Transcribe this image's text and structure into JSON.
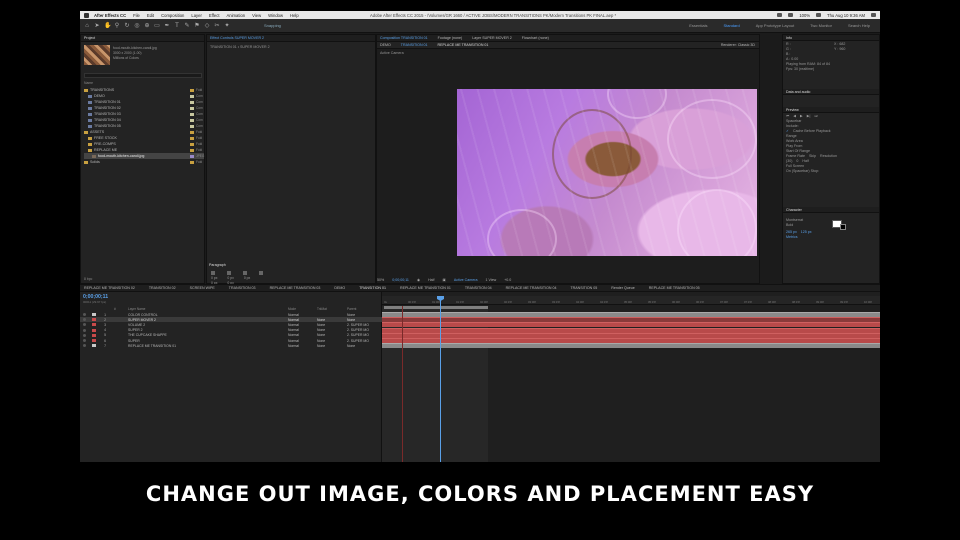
{
  "menubar": {
    "app": "After Effects CC",
    "items": [
      "File",
      "Edit",
      "Composition",
      "Layer",
      "Effect",
      "Animation",
      "View",
      "Window",
      "Help"
    ],
    "doc_title": "Adobe After Effects CC 2015 - /Volumes/GR 1660 / ACTIVE JOBS/MODERN TRANSITIONS PK/Modern Transitions PK FINAL.aep *",
    "status": "Thu Aug 10  9:36 AM",
    "battery": "100%"
  },
  "toolbar": {
    "snapping": "Snapping",
    "workspaces": [
      "Essentials",
      "Standard",
      "App Prototype Layout",
      "Two Monitor"
    ],
    "active_workspace": "Standard",
    "search": "Search Help"
  },
  "project": {
    "tab": "Project",
    "effect_tab": "Effect Controls SUPER MOVER 2",
    "item_name": "food-mouth-kitchen-candi.jpg",
    "item_info": [
      "3000 x 2000 (1.00)",
      "Millions of Colors"
    ],
    "col_name": "Name",
    "rows": [
      {
        "name": "TRANSITIONS",
        "type": "folder",
        "kind": "Fold",
        "indent": 0
      },
      {
        "name": "DEMO",
        "type": "comp",
        "kind": "Com",
        "indent": 1
      },
      {
        "name": "TRANSITION 01",
        "type": "comp",
        "kind": "Com",
        "indent": 1
      },
      {
        "name": "TRANSITION 02",
        "type": "comp",
        "kind": "Com",
        "indent": 1
      },
      {
        "name": "TRANSITION 03",
        "type": "comp",
        "kind": "Com",
        "indent": 1
      },
      {
        "name": "TRANSITION 04",
        "type": "comp",
        "kind": "Com",
        "indent": 1
      },
      {
        "name": "TRANSITION 05",
        "type": "comp",
        "kind": "Com",
        "indent": 1
      },
      {
        "name": "ASSETS",
        "type": "folder",
        "kind": "Fold",
        "indent": 0
      },
      {
        "name": "FREE STOCK",
        "type": "folder",
        "kind": "Fold",
        "indent": 1
      },
      {
        "name": "PRE-COMPS",
        "type": "folder",
        "kind": "Fold",
        "indent": 1
      },
      {
        "name": "REPLACE ME",
        "type": "folder",
        "kind": "Fold",
        "indent": 1
      },
      {
        "name": "food-mouth-kitchen-candi.jpg",
        "type": "image",
        "kind": "JPEG",
        "indent": 2,
        "selected": true
      },
      {
        "name": "Solids",
        "type": "folder",
        "kind": "Fold",
        "indent": 0
      }
    ],
    "footer": "8 bpc"
  },
  "effect_controls": {
    "subtitle": "TRANSITION 01 • SUPER MOVER 2"
  },
  "paragraph": {
    "tab": "Paragraph",
    "rows": [
      [
        "0 px",
        "0 px",
        "0 px"
      ],
      [
        "0 px",
        "0 px"
      ]
    ]
  },
  "viewer": {
    "tabs": [
      "Composition TRANSITION 01",
      "Footage (none)",
      "Layer SUPER MOVER 2",
      "Flowchart (none)"
    ],
    "crumbs": [
      "DEMO",
      "TRANSITION 01",
      "REPLACE ME TRANSITION 01"
    ],
    "camera": "Active Camera",
    "renderer_label": "Renderer:",
    "renderer": "Classic 3D",
    "zoom": "50%",
    "timecode": "0;00;00;11",
    "resolution": "Half",
    "view_camera": "Active Camera",
    "views": "1 View",
    "exposure": "+0.0"
  },
  "right_panel": {
    "info_tab": "Info",
    "info_lines": [
      "R :",
      "G :",
      "B :",
      "A : 0.00",
      "X : 682",
      "Y : 960"
    ],
    "info_footer": [
      "Playing from RAM: 84 of 84",
      "Fps: 30 (realtime)"
    ],
    "audio_tab": "Data and audio",
    "preview_tab": "Preview",
    "preview_shortcut": "Spacebar",
    "preview_include": "Include:",
    "preview_cache": "Cache Before Playback",
    "range_label": "Range",
    "range_value": "Work Area",
    "play_from_label": "Play From",
    "play_from_value": "Start Of Range",
    "frame_rate_label": "Frame Rate",
    "skip_label": "Skip",
    "resolution_label": "Resolution",
    "frame_rate": "(30)",
    "skip": "0",
    "res_value": "Half",
    "full_screen": "Full Screen",
    "stop_label": "On (Spacebar) Stop:",
    "character_tab": "Character",
    "font": "Montserrat",
    "style": "Bold",
    "font_size": "265 px",
    "leading": "125 px",
    "tracking": "Metrics"
  },
  "timeline": {
    "tabs": [
      "REPLACE ME TRANSITION 02",
      "TRANSITION 02",
      "SCREEN WIPE",
      "TRANSITION 03",
      "REPLACE ME TRANSITION 03",
      "DEMO",
      "TRANSITION 01",
      "REPLACE ME TRANSITION 01",
      "TRANSITION 04",
      "REPLACE ME TRANSITION 04",
      "TRANSITION 05",
      "Render Queue",
      "REPLACE ME TRANSITION 05"
    ],
    "active_tab": "TRANSITION 01",
    "timecode": "0;00;00;11",
    "timecode_sub": "00011 (29.97 fps)",
    "col_heads": [
      "#",
      "Layer Name",
      "Mode",
      "TrkMat",
      "Parent"
    ],
    "layers": [
      {
        "num": "1",
        "name": "COLOR CONTROL",
        "mode": "Normal",
        "trk": "",
        "parent": "None",
        "color": "#c8c8c8",
        "bar": "gray"
      },
      {
        "num": "2",
        "name": "SUPER MOVER 2",
        "mode": "Normal",
        "trk": "None",
        "parent": "None",
        "color": "#c84a4a",
        "bar": "red",
        "selected": true
      },
      {
        "num": "3",
        "name": "VOLUME 2",
        "mode": "Normal",
        "trk": "None",
        "parent": "2. SUPER MO",
        "color": "#c84a4a",
        "bar": "red"
      },
      {
        "num": "4",
        "name": "SUPER 2",
        "mode": "Normal",
        "trk": "None",
        "parent": "2. SUPER MO",
        "color": "#c84a4a",
        "bar": "red"
      },
      {
        "num": "5",
        "name": "THE CUPCAKE SHAPPE",
        "mode": "Normal",
        "trk": "None",
        "parent": "2. SUPER MO",
        "color": "#c84a4a",
        "bar": "red"
      },
      {
        "num": "6",
        "name": "SUPER",
        "mode": "Normal",
        "trk": "None",
        "parent": "2. SUPER MO",
        "color": "#c84a4a",
        "bar": "red"
      },
      {
        "num": "7",
        "name": "REPLACE ME TRANSITION 01",
        "mode": "Normal",
        "trk": "None",
        "parent": "None",
        "color": "#c8c8c8",
        "bar": "gray"
      }
    ],
    "ruler_labels": [
      "0s",
      "00:15f",
      "01:00f",
      "01:15f",
      "02:00f",
      "02:15f",
      "03:00f",
      "03:15f",
      "04:00f",
      "04:15f",
      "05:00f",
      "05:15f",
      "06:00f",
      "06:15f",
      "07:00f",
      "07:15f",
      "08:00f",
      "08:15f",
      "09:00f",
      "09:15f",
      "10:00f"
    ]
  },
  "caption": "CHANGE OUT IMAGE, COLORS AND PLACEMENT EASY"
}
